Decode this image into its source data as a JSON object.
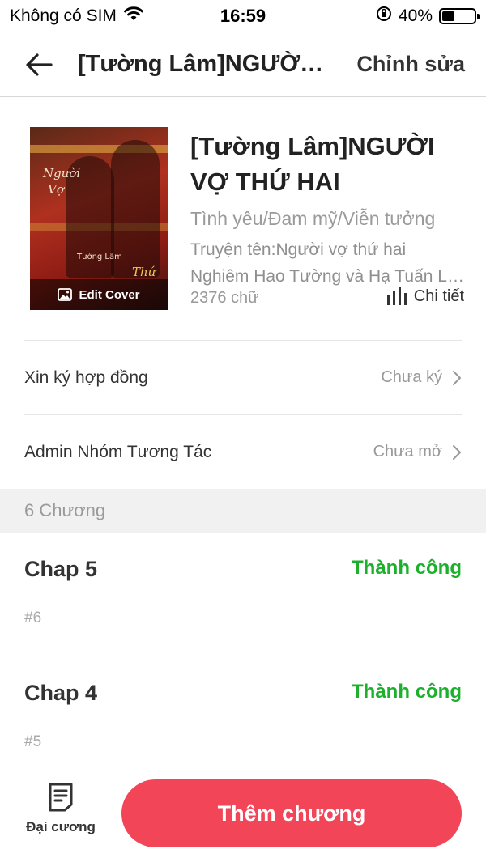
{
  "status_bar": {
    "carrier": "Không có SIM",
    "time": "16:59",
    "battery": "40%",
    "battery_level": 0.4
  },
  "nav": {
    "title": "[Tường Lâm]NGƯỜI VỢ THỨ HAI",
    "edit_label": "Chỉnh sửa"
  },
  "book": {
    "title": "[Tường Lâm]NGƯỜI VỢ THỨ HAI",
    "genre": "Tình yêu/Đam mỹ/Viễn tưởng",
    "desc_line1": "Truyện tên:Người vợ thứ hai",
    "desc_line2": "Nghiêm Hao Tường và Hạ Tuấn Lâm",
    "words": "2376 chữ",
    "detail_label": "Chi tiết",
    "edit_cover_label": "Edit Cover",
    "cover_text": {
      "script_1": "Người",
      "script_2": "Vợ",
      "small": "Tường Lâm",
      "script_3": "Thứ"
    }
  },
  "rows": [
    {
      "label": "Xin ký hợp đồng",
      "value": "Chưa ký"
    },
    {
      "label": "Admin Nhóm Tương Tác",
      "value": "Chưa mở"
    }
  ],
  "chapters": {
    "header": "6 Chương",
    "items": [
      {
        "title": "Chap 5",
        "status": "Thành công",
        "number": "#6"
      },
      {
        "title": "Chap 4",
        "status": "Thành công",
        "number": "#5"
      }
    ]
  },
  "bottom": {
    "outline_label": "Đại cương",
    "add_label": "Thêm chương"
  },
  "colors": {
    "accent": "#f24558",
    "success": "#1db02c"
  }
}
